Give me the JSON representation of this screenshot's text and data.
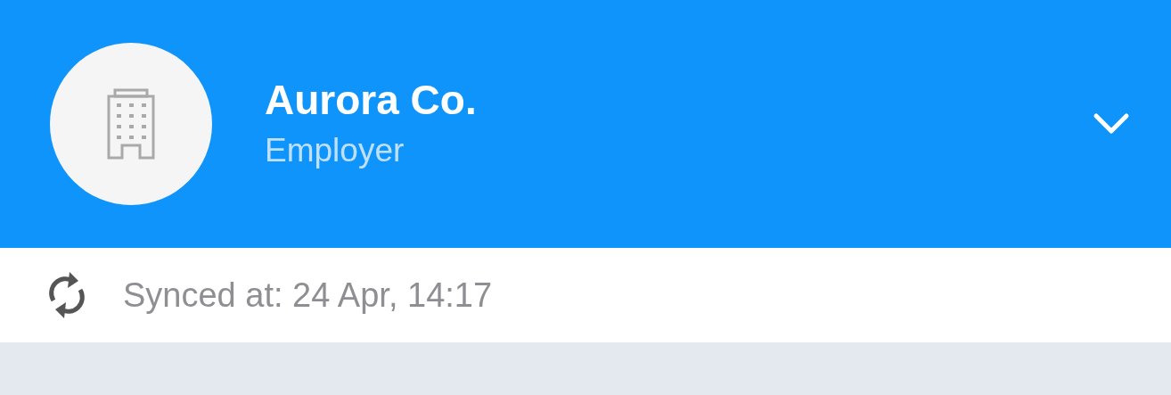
{
  "account": {
    "name": "Aurora Co.",
    "role": "Employer"
  },
  "sync": {
    "text": "Synced at: 24 Apr, 14:17"
  }
}
